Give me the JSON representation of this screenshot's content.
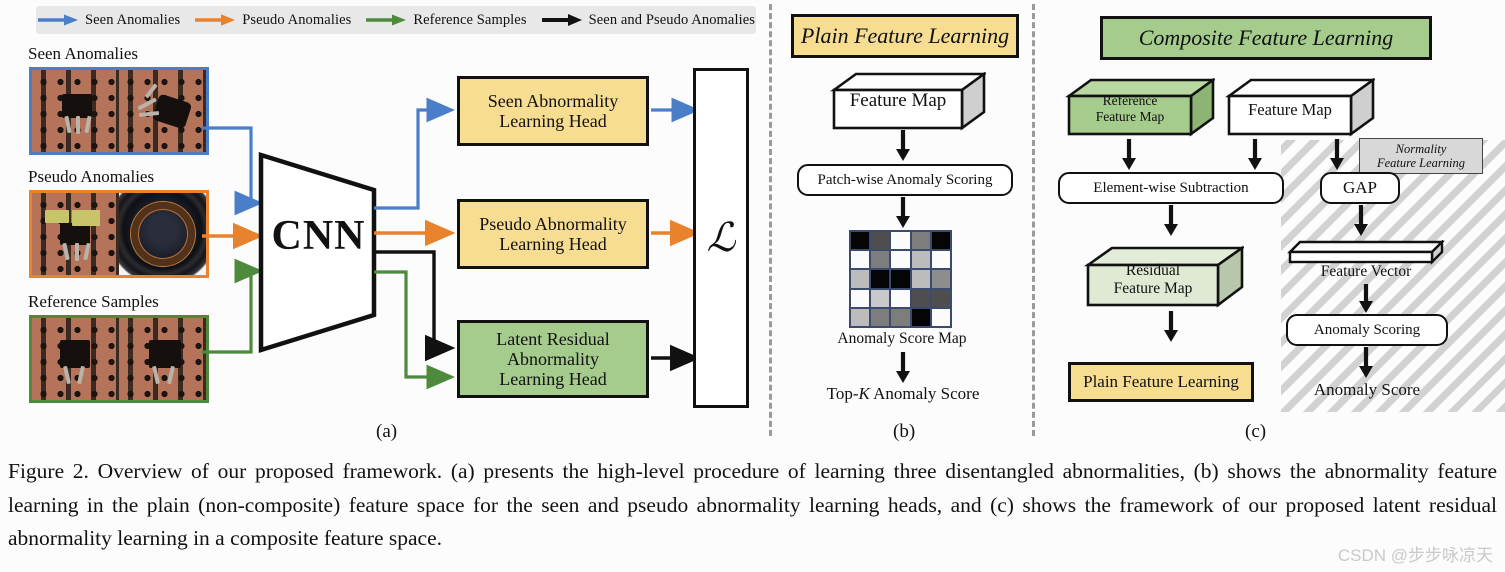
{
  "legend": {
    "items": [
      {
        "label": "Seen Anomalies",
        "color": "#4b7ec9",
        "icon": "arrow-right-icon"
      },
      {
        "label": "Pseudo Anomalies",
        "color": "#e8822c",
        "icon": "arrow-right-icon"
      },
      {
        "label": "Reference Samples",
        "color": "#4e8a3c",
        "icon": "arrow-right-icon"
      },
      {
        "label": "Seen and Pseudo Anomalies",
        "color": "#111111",
        "icon": "arrow-right-icon"
      }
    ]
  },
  "panel_a": {
    "label": "(a)",
    "groups": [
      {
        "title": "Seen Anomalies",
        "color": "#4b7ec9"
      },
      {
        "title": "Pseudo Anomalies",
        "color": "#e8822c"
      },
      {
        "title": "Reference Samples",
        "color": "#4e8a3c"
      }
    ],
    "backbone": "CNN",
    "heads": [
      {
        "line1": "Seen Abnormality",
        "line2": "Learning Head",
        "fill": "#f7dd91"
      },
      {
        "line1": "Pseudo Abnormality",
        "line2": "Learning Head",
        "fill": "#f7dd91"
      },
      {
        "line1": "Latent Residual",
        "line2": "Abnormality",
        "line3": "Learning  Head",
        "fill": "#a5cc8c"
      }
    ],
    "loss_symbol": "ℒ"
  },
  "panel_b": {
    "label": "(b)",
    "title": "Plain Feature Learning",
    "title_fill": "#f7dd91",
    "feature_map": "Feature Map",
    "scoring": "Patch-wise Anomaly Scoring",
    "score_map_caption": "Anomaly Score Map",
    "topk_prefix": "Top-",
    "topk_italic": "K",
    "topk_suffix": " Anomaly Score"
  },
  "panel_c": {
    "label": "(c)",
    "title": "Composite Feature Learning",
    "title_fill": "#a5cc8c",
    "reference_feature_map_l1": "Reference",
    "reference_feature_map_l2": "Feature Map",
    "feature_map": "Feature Map",
    "subtraction": "Element-wise Subtraction",
    "residual_l1": "Residual",
    "residual_l2": "Feature Map",
    "plain_feature_learning": "Plain Feature Learning",
    "normality_l1": "Normality",
    "normality_l2": "Feature Learning",
    "gap": "GAP",
    "feature_vector": "Feature Vector",
    "anomaly_scoring": "Anomaly Scoring",
    "anomaly_score": "Anomaly Score"
  },
  "chart_data": {
    "type": "heatmap",
    "title": "Anomaly Score Map",
    "rows": 5,
    "cols": 5,
    "colormap": "grayscale",
    "cell_border_color": "#3c4a70",
    "values": [
      [
        "#050505",
        "#4e4e4e",
        "#fbfbfb",
        "#7d7d7d",
        "#050505"
      ],
      [
        "#fbfbfb",
        "#7d7d7d",
        "#fbfbfb",
        "#bcbcbc",
        "#fbfbfb"
      ],
      [
        "#bcbcbc",
        "#050505",
        "#050505",
        "#bcbcbc",
        "#8d8d8d"
      ],
      [
        "#fbfbfb",
        "#c9c9c9",
        "#fbfbfb",
        "#4e4e4e",
        "#4e4e4e"
      ],
      [
        "#bcbcbc",
        "#7d7d7d",
        "#7d7d7d",
        "#050505",
        "#fbfbfb"
      ]
    ]
  },
  "caption": "Figure 2.  Overview of our proposed framework.  (a) presents the high-level procedure of learning three disentangled abnormalities, (b) shows the abnormality feature learning in the plain (non-composite) feature space for the seen and pseudo abnormality learning heads, and (c) shows the framework of our proposed latent residual abnormality learning in a composite feature space.",
  "watermark": "CSDN @步步咏凉天"
}
